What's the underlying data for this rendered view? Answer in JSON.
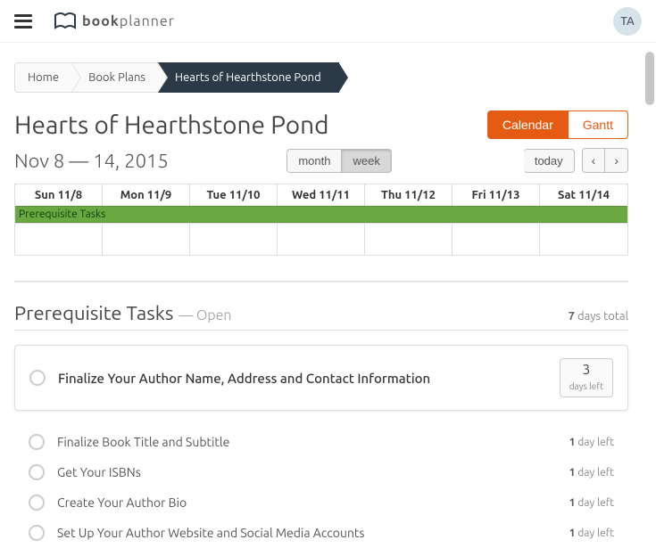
{
  "brand": {
    "bold": "book",
    "rest": "planner"
  },
  "avatar": "TA",
  "breadcrumb": [
    "Home",
    "Book Plans",
    "Hearts of Hearthstone Pond"
  ],
  "page_title": "Hearts of Hearthstone Pond",
  "view_toggle": {
    "calendar": "Calendar",
    "gantt": "Gantt"
  },
  "date_range": "Nov 8 — 14, 2015",
  "scale_toggle": {
    "month": "month",
    "week": "week",
    "active": "week"
  },
  "nav": {
    "today": "today",
    "prev": "‹",
    "next": "›"
  },
  "week_headers": [
    "Sun 11/8",
    "Mon 11/9",
    "Tue 11/10",
    "Wed 11/11",
    "Thu 11/12",
    "Fri 11/13",
    "Sat 11/14"
  ],
  "week_band": "Prerequisite Tasks",
  "section": {
    "title": "Prerequisite Tasks",
    "status": "— Open",
    "total_n": "7",
    "total_t": " days total"
  },
  "featured_task": {
    "title": "Finalize Your Author Name, Address and Contact Information",
    "days_n": "3",
    "days_t": "days left"
  },
  "tasks": [
    {
      "title": "Finalize Book Title and Subtitle",
      "n": "1",
      "t": " day left"
    },
    {
      "title": "Get Your ISBNs",
      "n": "1",
      "t": " day left"
    },
    {
      "title": "Create Your Author Bio",
      "n": "1",
      "t": " day left"
    },
    {
      "title": "Set Up Your Author Website and Social Media Accounts",
      "n": "1",
      "t": " day left"
    }
  ]
}
